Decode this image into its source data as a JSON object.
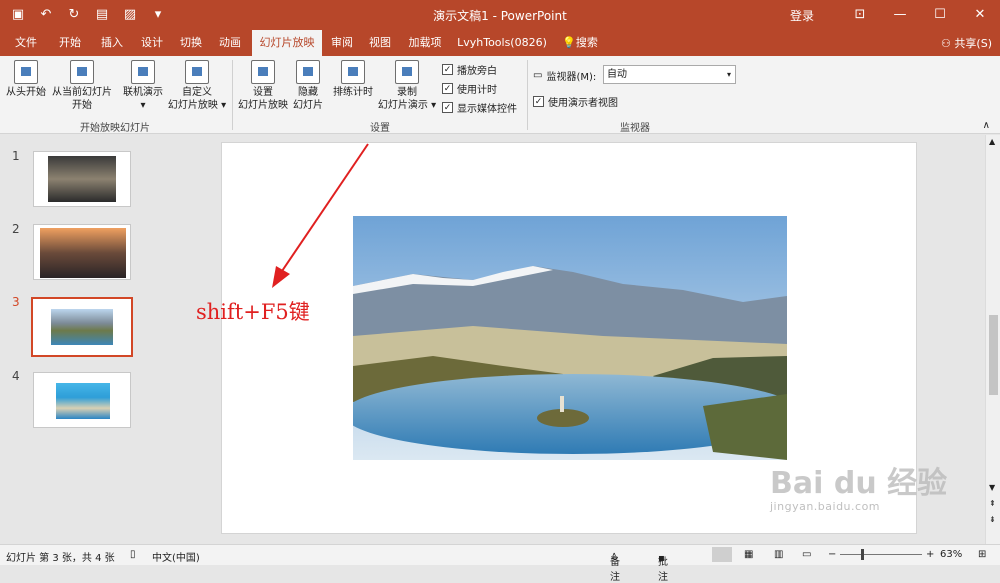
{
  "window": {
    "title": "演示文稿1 - PowerPoint",
    "login": "登录",
    "share": "共享(S)"
  },
  "tabs": [
    "文件",
    "开始",
    "插入",
    "设计",
    "切换",
    "动画",
    "幻灯片放映",
    "审阅",
    "视图",
    "加载项",
    "LvyhTools(0826)",
    "搜索"
  ],
  "active_tab": "幻灯片放映",
  "ribbon": {
    "from_start": "从头开始",
    "from_current_1": "从当前幻灯片",
    "from_current_2": "开始",
    "online_1": "联机演示",
    "online_2": "▾",
    "custom_1": "自定义",
    "custom_2": "幻灯片放映 ▾",
    "group_start": "开始放映幻灯片",
    "setup_1": "设置",
    "setup_2": "幻灯片放映",
    "hide_1": "隐藏",
    "hide_2": "幻灯片",
    "rehearse": "排练计时",
    "record_1": "录制",
    "record_2": "幻灯片演示 ▾",
    "chk_narration": "播放旁白",
    "chk_timing": "使用计时",
    "chk_media": "显示媒体控件",
    "group_setup": "设置",
    "monitor_label": "监视器(M):",
    "monitor_value": "自动",
    "presenter_view": "使用演示者视图",
    "group_monitor": "监视器"
  },
  "slides": [
    "1",
    "2",
    "3",
    "4"
  ],
  "selected_slide": "3",
  "annotation": "shift+F5键",
  "watermark": {
    "brand": "Bai du 经验",
    "url": "jingyan.baidu.com"
  },
  "status": {
    "slide_info": "幻灯片 第 3 张，共 4 张",
    "language": "中文(中国)",
    "notes": "备注",
    "comments": "批注",
    "zoom": "63%"
  },
  "colors": {
    "accent": "#b7472a",
    "selection": "#d24726",
    "annotation": "#e02020"
  }
}
